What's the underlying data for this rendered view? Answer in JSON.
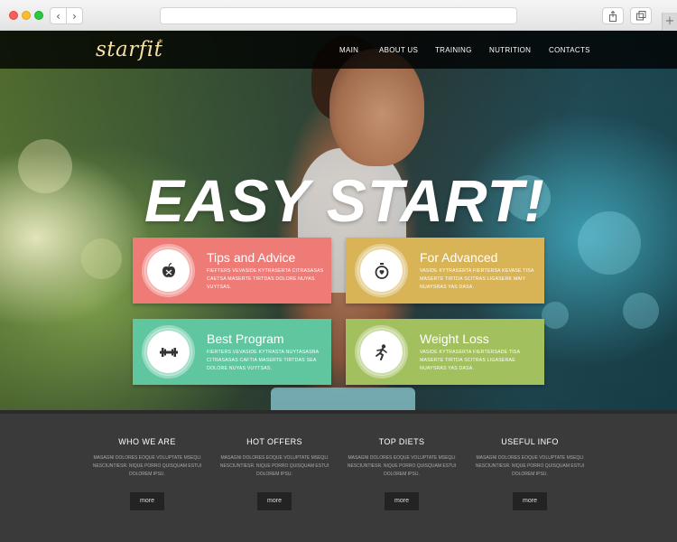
{
  "browser": {
    "back_glyph": "‹",
    "forward_glyph": "›",
    "new_tab_glyph": "+",
    "icons": [
      "share-icon",
      "tabs-icon"
    ]
  },
  "site": {
    "logo": "starfit",
    "logo_star": "*",
    "menu": [
      "MAIN",
      "ABOUT US",
      "TRAINING",
      "NUTRITION",
      "CONTACTS"
    ],
    "headline": "EASY START!"
  },
  "cards": [
    {
      "title": "Tips and Advice",
      "text": "Fiefters vevaside kytraserta citrasasas caetsa maserte tirtdas dolore nuyas vuytsas.",
      "icon": "apple-icon",
      "color": "#ef7b77"
    },
    {
      "title": "For Advanced",
      "text": "Vaside kytraserta fiertersa kevase tisa maserte tirtda scitras ligaserk maiy nuaysras yas dasa.",
      "icon": "stopwatch-icon",
      "color": "#d8b456"
    },
    {
      "title": "Best Program",
      "text": "Fierters vevaside kytrasta nuytasasra citrasasas caftia maserte tirtdas sea dolore nuyas vuytsas.",
      "icon": "dumbbell-icon",
      "color": "#5fc6a0"
    },
    {
      "title": "Weight Loss",
      "text": "Vaside kytraserta fiertersade tisa maserte tirtda scitras ligaserae nuaysras yas dasa.",
      "icon": "runner-icon",
      "color": "#a3c05e"
    }
  ],
  "footer": {
    "columns": [
      {
        "title": "WHO WE ARE",
        "text": "Masagni dolores eoque voluptate mseqli nesciuntiesr. Nique porro quisquam estui dolorem ipsu.",
        "button": "more"
      },
      {
        "title": "HOT OFFERS",
        "text": "Masagni dolores eoque voluptate mseqli nesciuntiesr. Nique porro quisquam estui dolorem ipsu.",
        "button": "more"
      },
      {
        "title": "TOP DIETS",
        "text": "Masagni dolores eoque voluptate mseqli nesciuntiesr. Nique porro quisquam estui dolorem ipsu.",
        "button": "more"
      },
      {
        "title": "USEFUL INFO",
        "text": "Masagni dolores eoque voluptate mseqli nesciuntiesr. Nique porro quisquam estui dolorem ipsu.",
        "button": "more"
      }
    ]
  }
}
